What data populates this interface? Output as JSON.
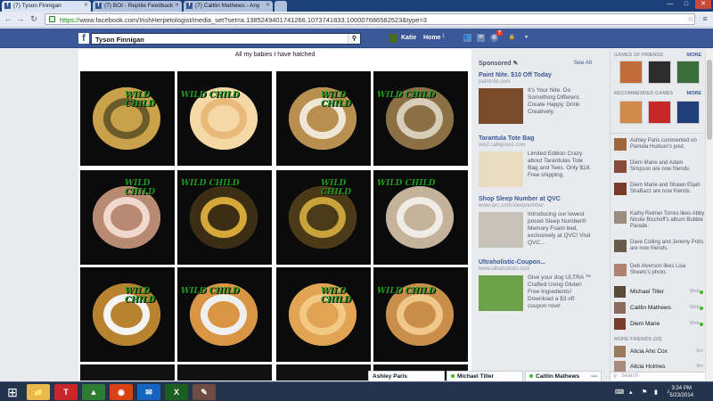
{
  "browser": {
    "tabs": [
      {
        "favicon": "f",
        "label": "(7) Tyson Finnigan"
      },
      {
        "favicon": "f",
        "label": "(7) BOI - Reptile Feedback"
      },
      {
        "favicon": "f",
        "label": "(7) Caitlin Mathews - Any"
      }
    ],
    "url_scheme": "https://",
    "url_rest": "www.facebook.com/IrishHerpetologist/media_set?set=a.1385249401741266.1073741833.100007686582523&type=3",
    "window_controls": [
      "—",
      "□",
      "✕"
    ]
  },
  "fb": {
    "logo": "f",
    "search_value": "Tyson Finnigan",
    "user_name": "Katie",
    "home_label": "Home",
    "home_count": "1",
    "notif_count": "7"
  },
  "album": {
    "title": "All my babies I have hatched",
    "watermark": "WILD CHILD",
    "photos": [
      {
        "bg": "#0b0b0b",
        "snake": "#6b5a2a",
        "snake2": "#c9a14a"
      },
      {
        "bg": "#0b0b0b",
        "snake": "#e9b97a",
        "snake2": "#f4d9a6"
      },
      {
        "bg": "#0b0b0b",
        "snake": "#efe6d6",
        "snake2": "#b88f4f"
      },
      {
        "bg": "#0b0b0b",
        "snake": "#d8cdb8",
        "snake2": "#8a7044"
      },
      {
        "bg": "#0b0b0b",
        "snake": "#f0d8cc",
        "snake2": "#b98a72"
      },
      {
        "bg": "#0b0b0b",
        "snake": "#d6a83a",
        "snake2": "#3b2e14"
      },
      {
        "bg": "#0b0b0b",
        "snake": "#c8a23a",
        "snake2": "#4a3a18"
      },
      {
        "bg": "#0b0b0b",
        "snake": "#f1ebe5",
        "snake2": "#c4b39a"
      },
      {
        "bg": "#0b0b0b",
        "snake": "#f4f4f4",
        "snake2": "#b9822f"
      },
      {
        "bg": "#0b0b0b",
        "snake": "#efefef",
        "snake2": "#d99544"
      },
      {
        "bg": "#0b0b0b",
        "snake": "#f2c983",
        "snake2": "#e0a454"
      },
      {
        "bg": "#0b0b0b",
        "snake": "#f0c78a",
        "snake2": "#c98f4a"
      }
    ]
  },
  "sponsored": {
    "header": "Sponsored",
    "see_all": "See All",
    "ads": [
      {
        "title": "Paint Nite. $10 Off Today",
        "url": "paintnite.com",
        "body": "It's Your Nite. Do Something Different. Create Happy. Drink Creatively.",
        "img": "#7a4a2a"
      },
      {
        "title": "Tarantula Tote Bag",
        "url": "ww2.cafepress.com",
        "body": "Limited Edition Crazy about Tarantulas Tote Bag and Tees. Only $18. Free shipping.",
        "img": "#e8ddc2"
      },
      {
        "title": "Shop Sleep Number at QVC",
        "url": "www.qvc.com/sleepnumber",
        "body": "Introducing our lowest priced Sleep Number® Memory Foam bed, exclusively at QVC! Visit QVC...",
        "img": "#c7c2b8"
      },
      {
        "title": "Ultraholistic-Coupon...",
        "url": "www.ultraholistic.com",
        "body": "Give your dog ULTRA ™ Crafted Using Gluten Free Ingredients! Download a $3 off coupon now!",
        "img": "#6ea24a"
      }
    ]
  },
  "rail": {
    "games_friends_header": "GAMES OF FRIENDS",
    "recommended_header": "RECOMMENDED GAMES",
    "more_label": "MORE",
    "games_friends": [
      "#c46b3a",
      "#2d2d2d",
      "#3c6e3a"
    ],
    "recommended": [
      "#d08a4a",
      "#c62828",
      "#1e3f7a"
    ],
    "ticker": [
      {
        "text": "Ashley Paris commented on Pamela Hudson's post.",
        "av": "#a0663b"
      },
      {
        "text": "Diem Marie and Adam Simpson are now friends.",
        "av": "#8a4a3a"
      },
      {
        "text": "Diem Marie and Shawn Elijah ShaBazz are now friends.",
        "av": "#7a3a2a"
      },
      {
        "text": "Kathy Reimer Torres likes Abby Nicole Bischoff's album Bubble Parade.",
        "av": "#9c8c7c"
      },
      {
        "text": "Dave Colling and Jeremy Potts are now friends.",
        "av": "#6a5a4a"
      },
      {
        "text": "Deb Alverson likes Lisa Sheets's photo.",
        "av": "#b08070"
      }
    ],
    "chat_online": [
      {
        "name": "Michael Tiller",
        "status": "Web",
        "av": "#5a4a3a"
      },
      {
        "name": "Caitlin Mathews",
        "status": "Web",
        "av": "#8a6a5a"
      },
      {
        "name": "Diem Marie",
        "status": "Web",
        "av": "#7a3a2a"
      }
    ],
    "more_friends_header": "MORE FRIENDS (33)",
    "more_friends": [
      {
        "name": "Alicia Aho Cox",
        "status": "6m",
        "av": "#9a7a5a"
      },
      {
        "name": "Alicia Holmes",
        "status": "8m",
        "av": "#aa8a7a"
      }
    ],
    "search_placeholder": "Search"
  },
  "chat_tabs": [
    {
      "name": "Ashley Paris",
      "online": false
    },
    {
      "name": "Michael Tiller",
      "online": true
    },
    {
      "name": "Caitlin Mathews",
      "online": true
    }
  ],
  "taskbar": {
    "apps": [
      {
        "name": "explorer",
        "glyph": "📁",
        "color": "#e8b84a"
      },
      {
        "name": "app-t",
        "glyph": "T",
        "color": "#c62828"
      },
      {
        "name": "drive",
        "glyph": "▲",
        "color": "#2e7d32"
      },
      {
        "name": "chrome",
        "glyph": "◉",
        "color": "#d84315"
      },
      {
        "name": "outlook",
        "glyph": "✉",
        "color": "#1565c0"
      },
      {
        "name": "excel",
        "glyph": "X",
        "color": "#1b5e20"
      },
      {
        "name": "paint",
        "glyph": "✎",
        "color": "#6d4c41"
      }
    ],
    "time": "3:24 PM",
    "date": "5/23/2014"
  }
}
